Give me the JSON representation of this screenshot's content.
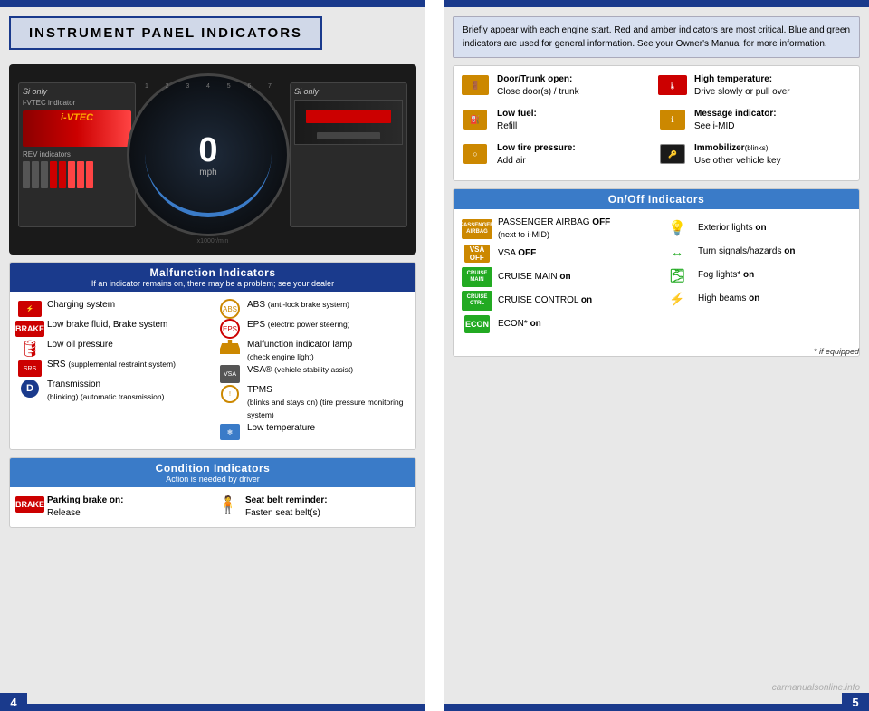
{
  "page": {
    "left_num": "4",
    "right_num": "5"
  },
  "header": {
    "title": "INSTRUMENT PANEL INDICATORS",
    "info_text": "Briefly appear with each engine start. Red and amber indicators are most critical. Blue and green indicators are used for general information. See your Owner's Manual for more information."
  },
  "dashboard": {
    "si_label": "Si only",
    "vtec_label": "i-VTEC indicator",
    "vtec_text": "i-VTEC",
    "rev_label": "REV indicators",
    "speed": "0",
    "speed_unit": "mph",
    "rpm_unit": "x1000r/min"
  },
  "malfunction": {
    "title": "Malfunction Indicators",
    "subtitle": "If an indicator remains on, there may be a problem; see your dealer",
    "items_left": [
      {
        "icon": "battery",
        "text": "Charging system"
      },
      {
        "icon": "brake",
        "text": "Low brake fluid, Brake system"
      },
      {
        "icon": "oil",
        "text": "Low oil pressure"
      },
      {
        "icon": "srs",
        "text": "SRS",
        "small": "(supplemental restraint system)"
      },
      {
        "icon": "d",
        "text": "Transmission",
        "small": "(blinking) (automatic transmission)"
      }
    ],
    "items_right": [
      {
        "icon": "abs",
        "text": "ABS",
        "small": "(anti-lock brake system)"
      },
      {
        "icon": "eps",
        "text": "EPS",
        "small": "(electric power steering)"
      },
      {
        "icon": "engine",
        "text": "Malfunction indicator lamp",
        "small": "(check engine light)"
      },
      {
        "icon": "vsa",
        "text": "VSA®",
        "small": "(vehicle stability assist)"
      },
      {
        "icon": "tpms",
        "text": "TPMS",
        "small": "(blinks and stays on) (tire pressure monitoring system)"
      },
      {
        "icon": "temp_low",
        "text": "Low temperature"
      }
    ]
  },
  "condition": {
    "title": "Condition Indicators",
    "subtitle": "Action is needed by driver",
    "items": [
      {
        "icon": "brake_red",
        "label_bold": "Parking brake on:",
        "label": "Release"
      },
      {
        "icon": "seatbelt",
        "label_bold": "Seat belt reminder:",
        "label": "Fasten seat belt(s)"
      }
    ]
  },
  "info_indicators": {
    "items": [
      {
        "icon": "door",
        "text_bold": "Door/Trunk open:",
        "text": "Close door(s) / trunk"
      },
      {
        "icon": "fuel",
        "text_bold": "Low fuel:",
        "text": "Refill"
      },
      {
        "icon": "tire_pres",
        "text_bold": "Low tire pressure:",
        "text": "Add air"
      }
    ],
    "items_right": [
      {
        "icon": "high_temp",
        "text_bold": "High temperature:",
        "text": "Drive slowly or pull over"
      },
      {
        "icon": "message",
        "text_bold": "Message indicator:",
        "text": "See i-MID"
      },
      {
        "icon": "immobilizer",
        "text_bold": "Immobilizer",
        "text_small": "(blinks):",
        "text": "Use other vehicle key"
      }
    ]
  },
  "onoff": {
    "title": "On/Off Indicators",
    "items_left": [
      {
        "icon": "airbag",
        "text": "PASSENGER AIRBAG ",
        "text_bold": "OFF",
        "subtext": "(next to i-MID)"
      },
      {
        "icon": "vsa_off",
        "text": "VSA ",
        "text_bold": "OFF"
      },
      {
        "icon": "cruise_main",
        "text": "CRUISE MAIN ",
        "text_bold": "on"
      },
      {
        "icon": "cruise_ctrl",
        "text": "CRUISE CONTROL ",
        "text_bold": "on"
      },
      {
        "icon": "econ",
        "text": "ECON* ",
        "text_bold": "on"
      }
    ],
    "items_right": [
      {
        "icon": "ext_lights",
        "text": "Exterior lights ",
        "text_bold": "on"
      },
      {
        "icon": "turn_signal",
        "text": "Turn signals/hazards ",
        "text_bold": "on"
      },
      {
        "icon": "fog",
        "text": "Fog lights* ",
        "text_bold": "on"
      },
      {
        "icon": "high_beam",
        "text": "High beams ",
        "text_bold": "on"
      }
    ],
    "footnote": "* if equipped"
  }
}
